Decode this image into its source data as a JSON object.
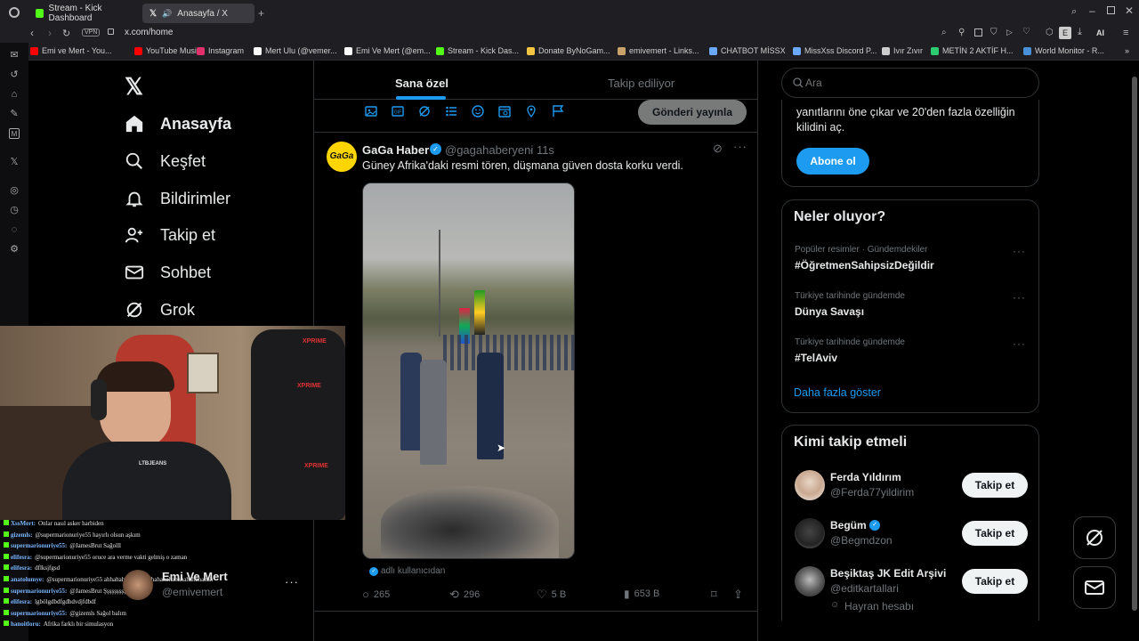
{
  "browser": {
    "tabs": [
      {
        "label": "Stream - Kick Dashboard",
        "color": "#53fc18"
      },
      {
        "label": "Anasayfa / X",
        "color": "#ffffff"
      }
    ],
    "url": "x.com/home",
    "vpn_label": "VPN",
    "extension_badge": "E",
    "ai_label": "AI",
    "bookmarks": [
      {
        "label": "Emi ve Mert - You...",
        "color": "#ff0000"
      },
      {
        "label": "YouTube Music",
        "color": "#ff0000"
      },
      {
        "label": "Instagram",
        "color": "#e1306c"
      },
      {
        "label": "Mert Ulu (@vemer...",
        "color": "#ffffff"
      },
      {
        "label": "Emi Ve Mert (@em...",
        "color": "#ffffff"
      },
      {
        "label": "Stream - Kick Das...",
        "color": "#53fc18"
      },
      {
        "label": "Donate ByNoGam...",
        "color": "#f4c542"
      },
      {
        "label": "emivemert - Links...",
        "color": "#c9a26b"
      },
      {
        "label": "CHATBOT MİSSX",
        "color": "#6aa9ff"
      },
      {
        "label": "MissXss Discord P...",
        "color": "#6aa9ff"
      },
      {
        "label": "Ivır Zıvır",
        "color": "#cccccc"
      },
      {
        "label": "METİN 2 AKTİF H...",
        "color": "#2ecc71"
      },
      {
        "label": "World Monitor - R...",
        "color": "#4a90d9"
      }
    ]
  },
  "nav": {
    "items": [
      {
        "label": "Anasayfa",
        "icon": "home-icon"
      },
      {
        "label": "Keşfet",
        "icon": "search-icon"
      },
      {
        "label": "Bildirimler",
        "icon": "bell-icon"
      },
      {
        "label": "Takip et",
        "icon": "person-add-icon"
      },
      {
        "label": "Sohbet",
        "icon": "mail-icon"
      },
      {
        "label": "Grok",
        "icon": "grok-icon"
      }
    ]
  },
  "timeline": {
    "tabs": [
      "Sana özel",
      "Takip ediliyor"
    ],
    "post_button": "Gönderi yayınla",
    "tweet": {
      "author": "GaGa Haber",
      "handle": "@gagahaberyeni",
      "time": "· 11s",
      "avatar_text": "GaGa",
      "text": "Güney Afrika'daki resmi tören, düşmana güven dosta korku verdi.",
      "attribution": "adlı kullanıcıdan",
      "replies": "265",
      "reposts": "296",
      "likes": "5 B",
      "views": "653 B"
    }
  },
  "sidebar_right": {
    "search_placeholder": "Ara",
    "premium_text": "yanıtlarını öne çıkar ve 20'den fazla özelliğin kilidini aç.",
    "subscribe_button": "Abone ol",
    "trends_title": "Neler oluyor?",
    "trends": [
      {
        "meta": "Popüler resimler · Gündemdekiler",
        "name": "#ÖğretmenSahipsizDeğildir"
      },
      {
        "meta": "Türkiye tarihinde gündemde",
        "name": "Dünya Savaşı"
      },
      {
        "meta": "Türkiye tarihinde gündemde",
        "name": "#TelAviv"
      }
    ],
    "show_more": "Daha fazla göster",
    "who_title": "Kimi takip etmeli",
    "who": [
      {
        "name": "Ferda Yıldırım",
        "handle": "@Ferda77yildirim",
        "button": "Takip et",
        "verified": false
      },
      {
        "name": "Begüm",
        "handle": "@Begmdzon",
        "button": "Takip et",
        "verified": true
      },
      {
        "name": "Beşiktaş JK Edit Arşivi",
        "handle": "@editkartallari",
        "button": "Takip et",
        "verified": false,
        "sub": "Hayran hesabı"
      }
    ]
  },
  "account": {
    "name": "Emi Ve Mert",
    "handle": "@emivemert"
  },
  "chat": [
    {
      "user": "XssMert:",
      "msg": "Onlar nasıl asker harbiden"
    },
    {
      "user": "gizemls:",
      "msg": "@supermarionuriye55 hayırlı olsun aşkım"
    },
    {
      "user": "supermarionuriye55:",
      "msg": "@JamesBrut Sağolll"
    },
    {
      "user": "elifesra:",
      "msg": "@supermarionuriye55 oruce ara verme vakti gelmiş o zaman"
    },
    {
      "user": "elifesra:",
      "msg": "dflksjfgsd"
    },
    {
      "user": "anatolumye:",
      "msg": "@supermarionuriye55 ahhahahahahahahahahahahahahahahahahah"
    },
    {
      "user": "supermarionuriye55:",
      "msg": "@JamesBrut Şşşşşşşşşşş"
    },
    {
      "user": "elifesra:",
      "msg": "lgbölgdbdfgdbdvdjfdbdf"
    },
    {
      "user": "supermarionuriye55:",
      "msg": "@gizemls Sağol balım"
    },
    {
      "user": "hanoitloru:",
      "msg": "Afrika farklı bir simulasyon"
    }
  ],
  "colors": {
    "accent": "#1d9bf0",
    "kick_green": "#53fc18",
    "background": "#000000",
    "border": "#2f3336"
  }
}
